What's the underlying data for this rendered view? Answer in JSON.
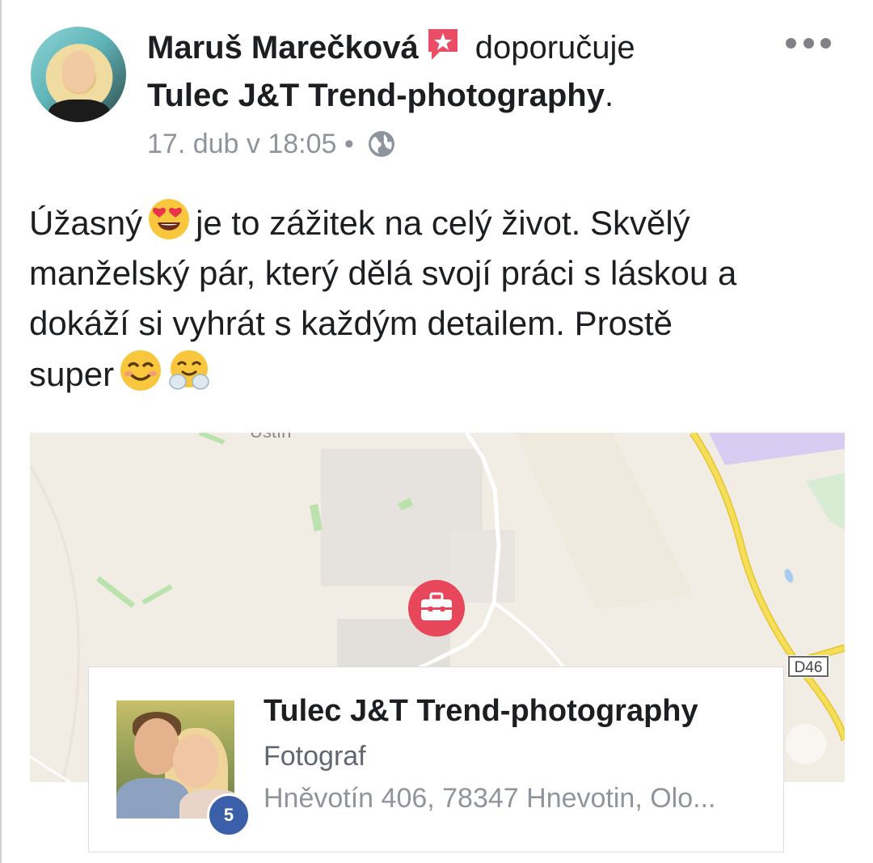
{
  "post": {
    "author": "Maruš Marečková",
    "action": "doporučuje",
    "page_name": "Tulec J&T Trend-photography",
    "period": ".",
    "timestamp": "17. dub v 18:05",
    "separator": "•",
    "text_lines": [
      {
        "before": "Úžasný",
        "after": "je to zážitek na celý život. Skvělý"
      },
      {
        "text": "manželský pár, který dělá svojí práci s láskou a"
      },
      {
        "text": "dokáží si vyhrát s každým detailem. Prostě"
      },
      {
        "before": "super",
        "after": ""
      }
    ]
  },
  "map": {
    "top_label": "Ústín",
    "road_sign": "D46",
    "pin_icon": "briefcase-icon",
    "colors": {
      "pin": "#e8465a",
      "road_major": "#f2d94e",
      "land": "#f1ece4"
    }
  },
  "card": {
    "title": "Tulec J&T Trend-photography",
    "category": "Fotograf",
    "address": "Hněvotín 406, 78347 Hnevotin, Olo...",
    "badge_count": "5",
    "badge_color": "#3b5fa8"
  }
}
